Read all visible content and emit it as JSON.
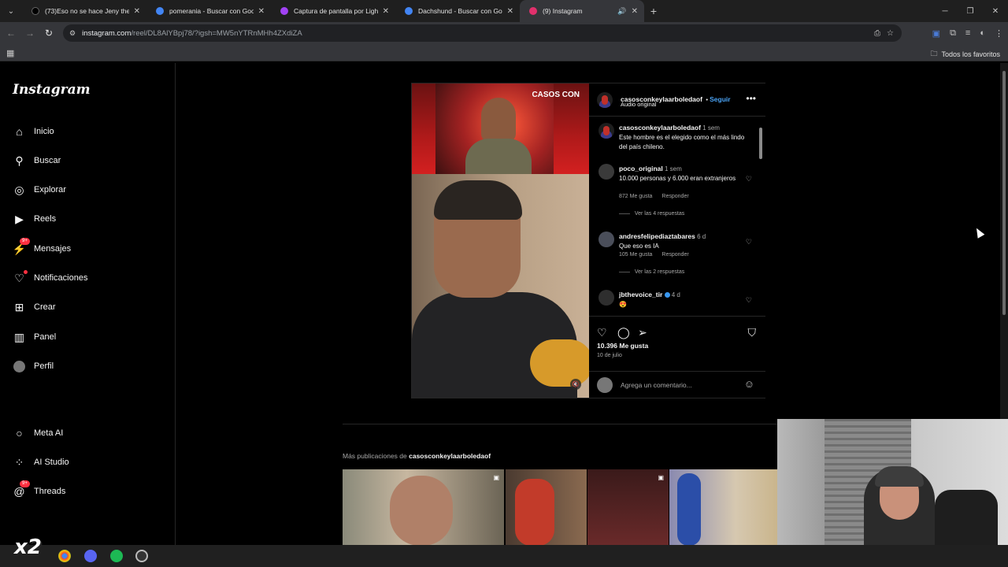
{
  "browser": {
    "tabs": [
      {
        "title": "(73)Eso no se hace Jeny the vo",
        "favicon_color": "#000000",
        "active": false
      },
      {
        "title": "pomerania - Buscar con Google",
        "favicon_color": "#4285f4",
        "active": false
      },
      {
        "title": "Captura de pantalla por Lightsh",
        "favicon_color": "#a142f4",
        "active": false
      },
      {
        "title": "Dachshund - Buscar con Google",
        "favicon_color": "#4285f4",
        "active": false
      },
      {
        "title": "(9) Instagram",
        "favicon_color": "#e1306c",
        "active": true
      }
    ],
    "url_host": "instagram.com",
    "url_path": "/reel/DL8AlYBpj78/?igsh=MW5nYTRnMHh4ZXdiZA",
    "bookmarks_folder": "Todos los favoritos"
  },
  "sidebar": {
    "logo": "Instagram",
    "items": [
      {
        "label": "Inicio",
        "icon": "home-icon"
      },
      {
        "label": "Buscar",
        "icon": "search-icon"
      },
      {
        "label": "Explorar",
        "icon": "compass-icon"
      },
      {
        "label": "Reels",
        "icon": "reels-icon"
      },
      {
        "label": "Mensajes",
        "icon": "messenger-icon",
        "badge": "9+"
      },
      {
        "label": "Notificaciones",
        "icon": "heart-icon"
      },
      {
        "label": "Crear",
        "icon": "plus-icon"
      },
      {
        "label": "Panel",
        "icon": "chart-icon"
      },
      {
        "label": "Perfil",
        "icon": "avatar-icon"
      },
      {
        "label": "Meta AI",
        "icon": "ring-icon"
      },
      {
        "label": "AI Studio",
        "icon": "ai-studio-icon"
      },
      {
        "label": "Threads",
        "icon": "threads-icon",
        "badge": "9+"
      }
    ]
  },
  "post": {
    "video_overlay_text": "CASOS CON",
    "author": "casosconkeylaarboledaof",
    "follow_label": "Seguir",
    "audio": "Audio original",
    "caption": {
      "user": "casosconkeylaarboledaof",
      "time": "1 sem",
      "text": "Este hombre es el elegido como el más lindo del país chileno."
    },
    "comments": [
      {
        "user": "poco_original",
        "time": "1 sem",
        "text": "10.000 personas y 6.000 eran extranjeros",
        "likes": "872 Me gusta",
        "reply": "Responder",
        "replies": "Ver las 4 respuestas"
      },
      {
        "user": "andresfelipediaztabares",
        "time": "6 d",
        "text": "Que eso es IA",
        "likes": "105 Me gusta",
        "reply": "Responder",
        "replies": "Ver las 2 respuestas"
      },
      {
        "user": "jbthevoice_tir",
        "time": "4 d",
        "text": "😍",
        "verified": true
      }
    ],
    "like_count": "10.396 Me gusta",
    "date": "10 de julio",
    "comment_placeholder": "Agrega un comentario..."
  },
  "more_posts": {
    "label": "Más publicaciones de",
    "user": "casosconkeylaarboledaof"
  },
  "overlay": {
    "speed_label": "x2"
  }
}
